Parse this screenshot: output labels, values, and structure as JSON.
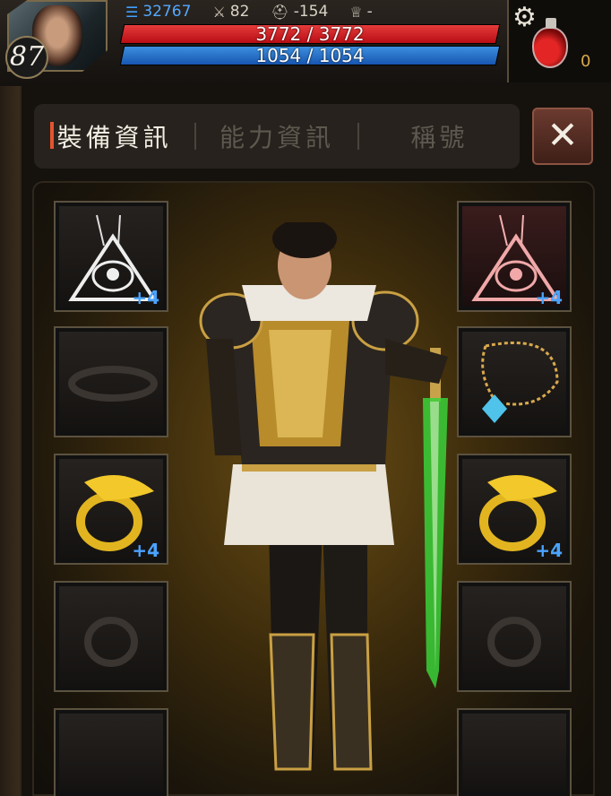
{
  "player": {
    "level": "87",
    "power": "32767",
    "attack": "82",
    "defense": "-154",
    "honor": "-",
    "hp": "3772 / 3772",
    "hp_fraction": 1.0,
    "mp": "1054 / 1054",
    "mp_fraction": 1.0,
    "potion_count": "0"
  },
  "tabs": [
    {
      "label": "裝備資訊",
      "active": true
    },
    {
      "label": "能力資訊",
      "active": false
    },
    {
      "label": "稱號",
      "active": false
    }
  ],
  "close_label": "✕",
  "slots": {
    "left": [
      {
        "name": "amulet-silver",
        "enhance": "+4",
        "filled": true
      },
      {
        "name": "belt",
        "enhance": "",
        "filled": false
      },
      {
        "name": "ring-gold",
        "enhance": "+4",
        "filled": true
      },
      {
        "name": "ring-empty",
        "enhance": "",
        "filled": false
      },
      {
        "name": "slot-empty",
        "enhance": "",
        "filled": false
      }
    ],
    "right": [
      {
        "name": "amulet-red",
        "enhance": "+4",
        "filled": true
      },
      {
        "name": "necklace",
        "enhance": "",
        "filled": true
      },
      {
        "name": "ring-gold",
        "enhance": "+4",
        "filled": true
      },
      {
        "name": "ring-empty",
        "enhance": "",
        "filled": false
      },
      {
        "name": "slot-empty",
        "enhance": "",
        "filled": false
      }
    ]
  },
  "colors": {
    "accent": "#e2552f",
    "hp": "#d3161c",
    "mp": "#2c7fd6",
    "enhance": "#4aa3ff",
    "gold": "#d9a94b"
  }
}
